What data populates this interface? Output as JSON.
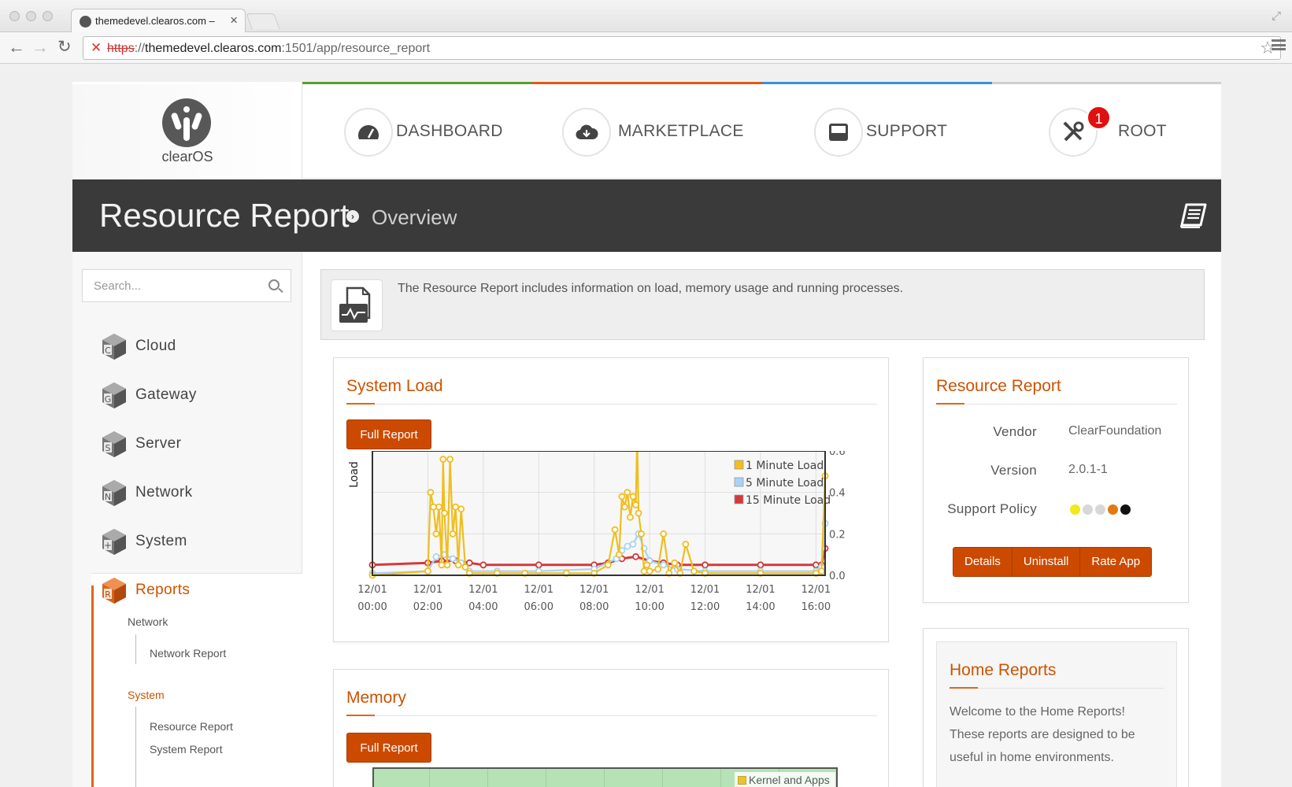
{
  "browser": {
    "tab_title": "themedevel.clearos.com –",
    "url_scheme": "https",
    "url_sep": "://",
    "url_host": "themedevel.clearos.com",
    "url_rest": ":1501/app/resource_report"
  },
  "brand": {
    "name": "clearOS"
  },
  "nav": {
    "dashboard": "DASHBOARD",
    "marketplace": "MARKETPLACE",
    "support": "SUPPORT",
    "root": "ROOT",
    "root_badge": "1"
  },
  "accent_colors": [
    "#5a9e2a",
    "#e05a12",
    "#3d8fd8",
    "#cfcfcf"
  ],
  "page": {
    "title": "Resource Report",
    "breadcrumb": "Overview"
  },
  "sidebar": {
    "search_placeholder": "Search...",
    "categories": [
      {
        "letter": "C",
        "label": "Cloud"
      },
      {
        "letter": "G",
        "label": "Gateway"
      },
      {
        "letter": "S",
        "label": "Server"
      },
      {
        "letter": "N",
        "label": "Network"
      },
      {
        "letter": "+",
        "label": "System"
      },
      {
        "letter": "R",
        "label": "Reports"
      }
    ],
    "reports_sections": [
      {
        "heading": "Network",
        "links": [
          "Network Report"
        ]
      },
      {
        "heading": "System",
        "links": [
          "Resource Report",
          "System Report"
        ]
      }
    ]
  },
  "intro": {
    "text": "The Resource Report includes information on load, memory usage and running processes."
  },
  "system_load": {
    "title": "System Load",
    "button": "Full Report"
  },
  "memory": {
    "title": "Memory",
    "button": "Full Report"
  },
  "app_info": {
    "title": "Resource Report",
    "vendor_label": "Vendor",
    "vendor": "ClearFoundation",
    "version_label": "Version",
    "version": "2.0.1-1",
    "policy_label": "Support Policy",
    "policy_dots": [
      "#f2e81a",
      "#d7d7d7",
      "#d7d7d7",
      "#e07a12",
      "#111111"
    ],
    "buttons": {
      "details": "Details",
      "uninstall": "Uninstall",
      "rate": "Rate App"
    }
  },
  "home_reports": {
    "title": "Home Reports",
    "lines": [
      "Welcome to the Home Reports!",
      "These reports are designed to be",
      "useful in home environments."
    ]
  },
  "chart_data": [
    {
      "type": "line",
      "ylabel": "Load",
      "ylim": [
        0,
        0.6
      ],
      "yticks": [
        "0.0",
        "0.2",
        "0.4",
        "0.6"
      ],
      "y_axis_side": "right",
      "xlim": [
        0,
        16.33
      ],
      "xtick_dates": [
        "12/01",
        "12/01",
        "12/01",
        "12/01",
        "12/01",
        "12/01",
        "12/01",
        "12/01",
        "12/01"
      ],
      "xtick_times": [
        "00:00",
        "02:00",
        "04:00",
        "06:00",
        "08:00",
        "10:00",
        "12:00",
        "14:00",
        "16:00"
      ],
      "grid": true,
      "legend": "top-right",
      "series": [
        {
          "name": "1 Minute Load",
          "color": "#f0be1e",
          "x": [
            0,
            2.0,
            2.1,
            2.2,
            2.3,
            2.4,
            2.5,
            2.55,
            2.6,
            2.7,
            2.8,
            2.9,
            3.0,
            3.1,
            3.2,
            3.35,
            3.5,
            4.5,
            5.5,
            7.0,
            8.0,
            8.5,
            8.75,
            8.9,
            9.0,
            9.1,
            9.2,
            9.3,
            9.4,
            9.5,
            9.55,
            9.6,
            9.7,
            9.8,
            9.9,
            10.0,
            10.3,
            10.5,
            10.7,
            10.9,
            11.1,
            11.3,
            11.6,
            12.0,
            14.0,
            16.0,
            16.2,
            16.33
          ],
          "y": [
            0.0,
            0.02,
            0.4,
            0.33,
            0.2,
            0.33,
            0.05,
            0.56,
            0.3,
            0.05,
            0.56,
            0.2,
            0.33,
            0.05,
            0.32,
            0.04,
            0.01,
            0.01,
            0.01,
            0.01,
            0.01,
            0.05,
            0.22,
            0.1,
            0.38,
            0.33,
            0.4,
            0.28,
            0.38,
            0.34,
            0.66,
            0.3,
            0.2,
            0.02,
            0.05,
            0.02,
            0.03,
            0.2,
            0.01,
            0.06,
            0.01,
            0.15,
            0.02,
            0.01,
            0.01,
            0.01,
            0.02,
            0.48
          ]
        },
        {
          "name": "5 Minute Load",
          "color": "#a9d3f5",
          "x": [
            0,
            2.0,
            2.3,
            2.6,
            2.9,
            3.2,
            3.5,
            4.5,
            6.0,
            8.0,
            8.8,
            9.0,
            9.2,
            9.4,
            9.6,
            9.8,
            10.0,
            10.5,
            11.0,
            12.0,
            14.0,
            16.0,
            16.2,
            16.33
          ],
          "y": [
            0.01,
            0.02,
            0.09,
            0.1,
            0.08,
            0.06,
            0.02,
            0.02,
            0.02,
            0.03,
            0.08,
            0.12,
            0.14,
            0.15,
            0.2,
            0.13,
            0.07,
            0.05,
            0.03,
            0.02,
            0.02,
            0.02,
            0.04,
            0.25
          ]
        },
        {
          "name": "15 Minute Load",
          "color": "#d23a3a",
          "x": [
            0,
            2.0,
            2.5,
            3.0,
            3.5,
            4.0,
            6.0,
            8.0,
            8.5,
            9.0,
            9.5,
            10.0,
            10.5,
            11.0,
            12.0,
            14.0,
            16.0,
            16.2,
            16.33
          ],
          "y": [
            0.05,
            0.06,
            0.07,
            0.07,
            0.06,
            0.05,
            0.05,
            0.05,
            0.06,
            0.08,
            0.09,
            0.07,
            0.06,
            0.05,
            0.05,
            0.05,
            0.05,
            0.05,
            0.13
          ]
        }
      ]
    },
    {
      "type": "area",
      "series": [
        {
          "name": "Kernel and Apps",
          "color": "#f0be1e"
        }
      ]
    }
  ]
}
